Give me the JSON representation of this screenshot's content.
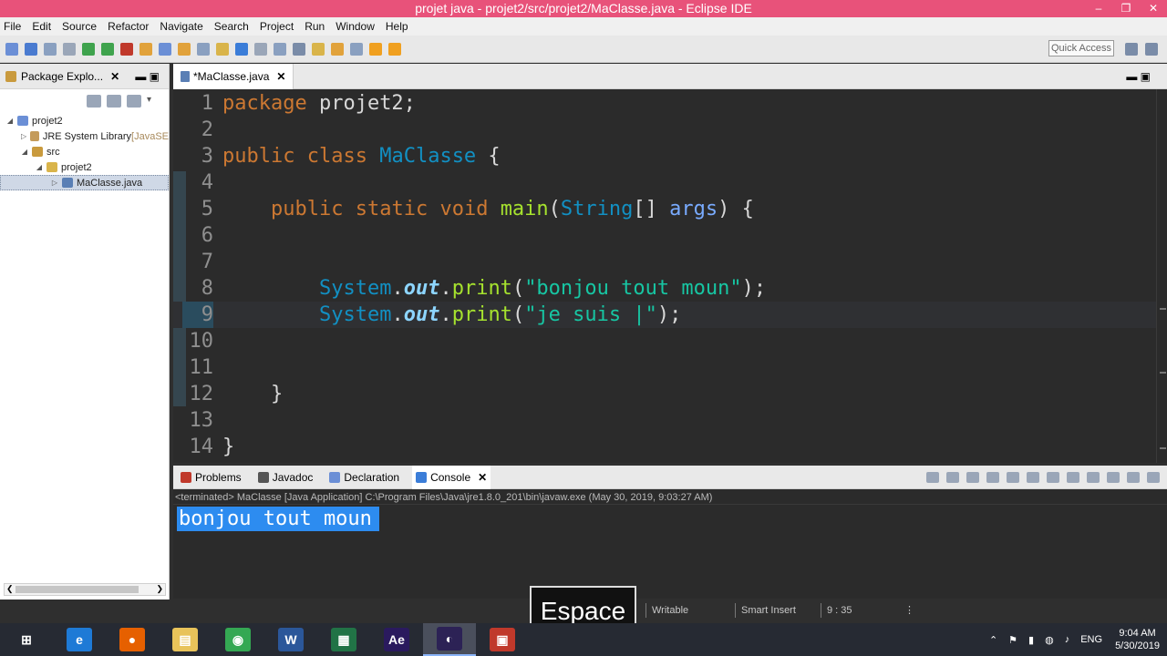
{
  "window": {
    "title": "projet java - projet2/src/projet2/MaClasse.java - Eclipse IDE",
    "controls": [
      "‒",
      "❐",
      "✕"
    ]
  },
  "menu": [
    "File",
    "Edit",
    "Source",
    "Refactor",
    "Navigate",
    "Search",
    "Project",
    "Run",
    "Window",
    "Help"
  ],
  "toolbar": {
    "quick_access": "Quick Access",
    "icon_colors": [
      "#6b8fd6",
      "#4a7bd0",
      "#8aa0c0",
      "#9aa6b8",
      "#3fa34d",
      "#3fa34d",
      "#c0392b",
      "#e1a23b",
      "#6b8fd6",
      "#e1a23b",
      "#8aa0c0",
      "#d9b44a",
      "#3b7dd8",
      "#9aa6b8",
      "#8aa0c0",
      "#7a8ca8",
      "#d9b44a",
      "#e1a23b",
      "#8aa0c0",
      "#f0a020",
      "#f0a020"
    ]
  },
  "package_explorer": {
    "title": "Package Explo...",
    "tree": [
      {
        "label": "projet2",
        "indent": 0,
        "arrow": "◢",
        "color": "#6b8fd6",
        "suffix": ""
      },
      {
        "label": "JRE System Library",
        "indent": 1,
        "arrow": "▷",
        "color": "#c49b5a",
        "suffix": " [JavaSE"
      },
      {
        "label": "src",
        "indent": 1,
        "arrow": "◢",
        "color": "#c99a3d",
        "suffix": ""
      },
      {
        "label": "projet2",
        "indent": 2,
        "arrow": "◢",
        "color": "#d9b44a",
        "suffix": ""
      },
      {
        "label": "MaClasse.java",
        "indent": 3,
        "arrow": "▷",
        "color": "#5a7fb5",
        "suffix": "",
        "selected": true
      }
    ]
  },
  "editor": {
    "tab_label": "*MaClasse.java",
    "current_line": 9,
    "lines": [
      {
        "n": "1",
        "html": "<span class='kw'>package</span> projet2;"
      },
      {
        "n": "2",
        "html": ""
      },
      {
        "n": "3",
        "html": "<span class='kw'>public</span> <span class='kw'>class</span> <span class='cls'>MaClasse</span> {"
      },
      {
        "n": "4",
        "html": ""
      },
      {
        "n": "5",
        "html": "    <span class='kw'>public</span> <span class='kw'>static</span> <span class='kw'>void</span> <span class='fn'>main</span>(<span class='cls'>String</span>[] <span class='arg'>args</span>) {"
      },
      {
        "n": "6",
        "html": ""
      },
      {
        "n": "7",
        "html": ""
      },
      {
        "n": "8",
        "html": "        <span class='cls'>System</span>.<span class='fld'>out</span>.<span class='fn'>print</span>(<span class='str'>\"bonjou tout moun\"</span>);"
      },
      {
        "n": "9",
        "html": "        <span class='cls'>System</span>.<span class='fld'>out</span>.<span class='fn'>print</span>(<span class='str'>\"je suis |\"</span>);"
      },
      {
        "n": "10",
        "html": ""
      },
      {
        "n": "11",
        "html": ""
      },
      {
        "n": "12",
        "html": "    }"
      },
      {
        "n": "13",
        "html": ""
      },
      {
        "n": "14",
        "html": "}"
      }
    ]
  },
  "console": {
    "tabs": [
      {
        "label": "Problems",
        "color": "#c0392b"
      },
      {
        "label": "Javadoc",
        "color": "#555"
      },
      {
        "label": "Declaration",
        "color": "#6b8fd6"
      },
      {
        "label": "Console",
        "color": "#3b7dd8",
        "active": true
      }
    ],
    "terminated": "<terminated> MaClasse [Java Application] C:\\Program Files\\Java\\jre1.8.0_201\\bin\\javaw.exe (May 30, 2019, 9:03:27 AM)",
    "output": "bonjou tout moun"
  },
  "status": {
    "writable": "Writable",
    "insert_mode": "Smart Insert",
    "position": "9 : 35",
    "key_overlay": "Espace"
  },
  "taskbar": {
    "apps": [
      {
        "name": "windows-start-icon",
        "label": "⊞",
        "color": "transparent"
      },
      {
        "name": "edge-icon",
        "label": "e",
        "color": "#1e7ad6"
      },
      {
        "name": "firefox-icon",
        "label": "●",
        "color": "#e66000"
      },
      {
        "name": "file-explorer-icon",
        "label": "▤",
        "color": "#e8c35a"
      },
      {
        "name": "chrome-icon",
        "label": "◉",
        "color": "#34a853"
      },
      {
        "name": "word-icon",
        "label": "W",
        "color": "#2b579a"
      },
      {
        "name": "excel-icon",
        "label": "▦",
        "color": "#217346"
      },
      {
        "name": "after-effects-icon",
        "label": "Ae",
        "color": "#2a1a5e"
      },
      {
        "name": "eclipse-icon",
        "label": "◐",
        "color": "#2c2255",
        "active": true
      },
      {
        "name": "screen-recorder-icon",
        "label": "▣",
        "color": "#c0392b"
      }
    ],
    "lang": "ENG",
    "time": "9:04 AM",
    "date": "5/30/2019"
  }
}
